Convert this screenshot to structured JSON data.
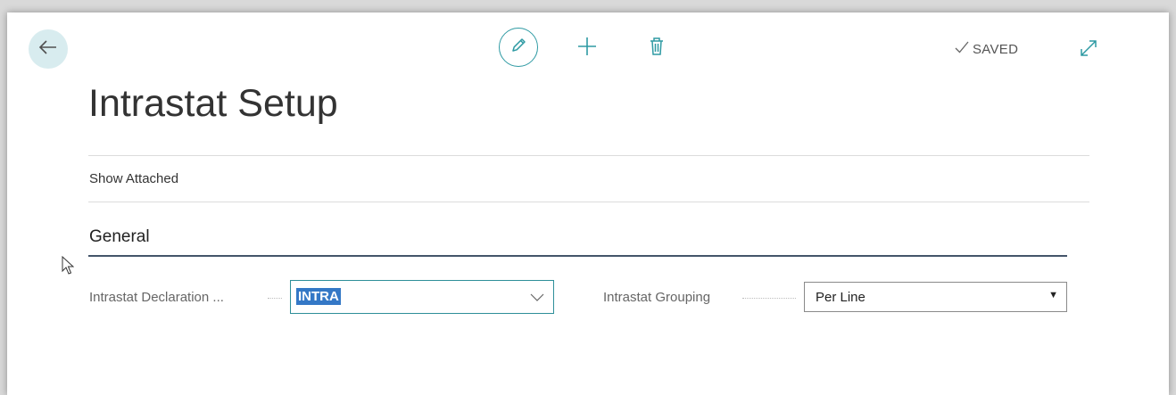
{
  "header": {
    "saved_label": "SAVED",
    "icons": {
      "back": "arrow-left-icon",
      "edit": "pencil-icon",
      "new": "plus-icon",
      "delete": "trash-icon",
      "saved": "checkmark-icon",
      "expand": "expand-icon"
    }
  },
  "page": {
    "title": "Intrastat Setup",
    "action_show_attached": "Show Attached"
  },
  "general": {
    "section_title": "General",
    "declaration_label": "Intrastat Declaration ...",
    "declaration_value": "INTRA",
    "grouping_label": "Intrastat Grouping",
    "grouping_value": "Per Line"
  },
  "colors": {
    "accent": "#2e9aa3",
    "selection": "#3478c6",
    "section_rule": "#44546a"
  }
}
